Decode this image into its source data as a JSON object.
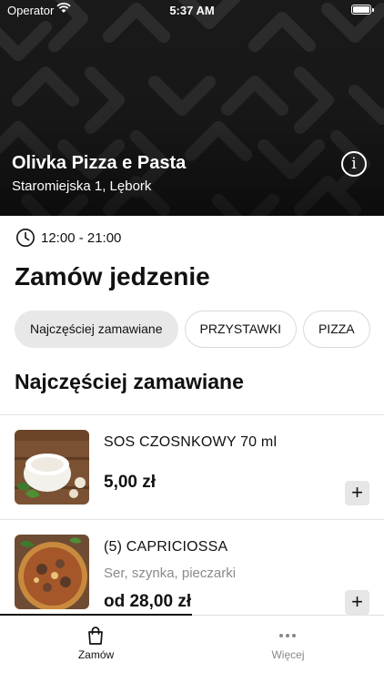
{
  "status_bar": {
    "carrier": "Operator",
    "time": "5:37 AM"
  },
  "restaurant": {
    "name": "Olivka Pizza e Pasta",
    "address": "Staromiejska 1, Lębork",
    "info_label": "i"
  },
  "hours": {
    "text": "12:00 - 21:00"
  },
  "page_title": "Zamów jedzenie",
  "categories": [
    {
      "label": "Najczęściej zamawiane",
      "active": true
    },
    {
      "label": "PRZYSTAWKI",
      "active": false
    },
    {
      "label": "PIZZA",
      "active": false
    }
  ],
  "section_title": "Najczęściej zamawiane",
  "items": [
    {
      "name": "SOS CZOSNKOWY 70 ml",
      "description": "",
      "price": "5,00 zł",
      "add_label": "+",
      "image": "garlic-sauce-photo"
    },
    {
      "name": "(5) CAPRICIOSSA",
      "description": "Ser, szynka, pieczarki",
      "price": "od 28,00 zł",
      "add_label": "+",
      "image": "pizza-photo"
    }
  ],
  "tabs": [
    {
      "label": "Zamów",
      "icon": "shopping-bag-icon",
      "active": true
    },
    {
      "label": "Więcej",
      "icon": "more-dots-icon",
      "active": false
    }
  ],
  "colors": {
    "hero_bg": "#1b1b1b",
    "chip_active": "#e8e8e8",
    "add_button": "#e6e6e6",
    "muted_text": "#8a8a8a"
  }
}
